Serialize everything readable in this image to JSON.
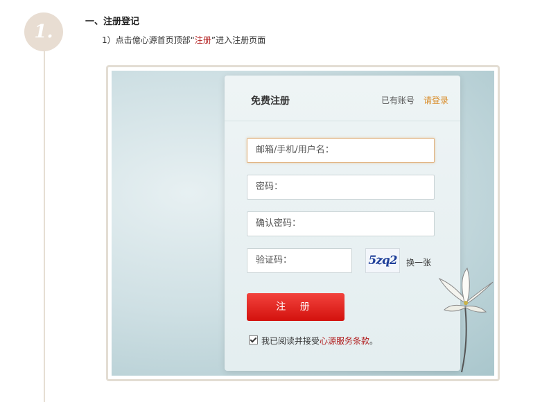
{
  "step": {
    "number": "1."
  },
  "section": {
    "title": "一、注册登记"
  },
  "instruction": {
    "prefix": "1）点击億心源首页顶部“",
    "highlight": "注册",
    "suffix": "”进入注册页面"
  },
  "register_panel": {
    "title": "免费注册",
    "has_account": "已有账号",
    "login_link": "请登录",
    "fields": {
      "account_placeholder": "邮箱/手机/用户名：",
      "password_placeholder": "密码：",
      "confirm_placeholder": "确认密码：",
      "captcha_placeholder": "验证码："
    },
    "captcha_text": "5zq2",
    "refresh_label": "换一张",
    "register_button": "注 册",
    "agree_prefix": "我已阅读并接受",
    "terms_link": "心源服务条款",
    "agree_suffix": "。",
    "agree_checked": true
  },
  "colors": {
    "accent": "#d3110d",
    "link": "#d98d2a",
    "badge": "#e8ddd2"
  }
}
